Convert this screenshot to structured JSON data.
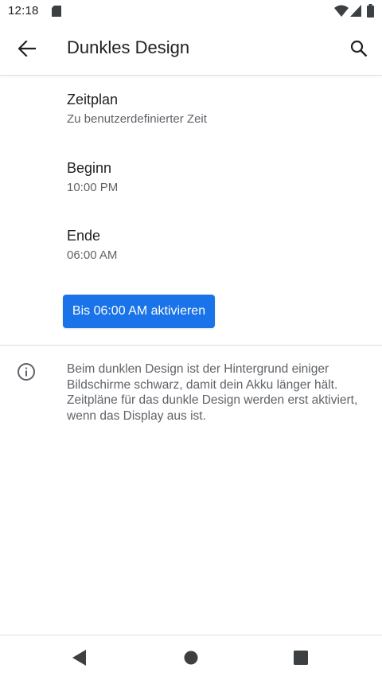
{
  "status_bar": {
    "time": "12:18",
    "icons": [
      "sim-card-icon",
      "wifi-icon",
      "cell-signal-icon",
      "battery-icon"
    ]
  },
  "app_bar": {
    "title": "Dunkles Design",
    "back_icon": "arrow-back-icon",
    "search_icon": "search-icon"
  },
  "preferences": [
    {
      "title": "Zeitplan",
      "summary": "Zu benutzerdefinierter Zeit"
    },
    {
      "title": "Beginn",
      "summary": "10:00 PM"
    },
    {
      "title": "Ende",
      "summary": "06:00 AM"
    }
  ],
  "activate_button": {
    "label": "Bis 06:00 AM aktivieren"
  },
  "footer_info": {
    "icon": "info-icon",
    "text": "Beim dunklen Design ist der Hintergrund einiger Bildschirme schwarz, damit dein Akku länger hält. Zeitpläne für das dunkle Design werden erst aktiviert, wenn das Display aus ist."
  },
  "nav_bar": {
    "icons": [
      "nav-back-icon",
      "nav-home-icon",
      "nav-recents-icon"
    ]
  },
  "colors": {
    "accent": "#1a73e8",
    "text_primary": "#202124",
    "text_secondary": "#5f6368",
    "divider": "#dadce0"
  }
}
